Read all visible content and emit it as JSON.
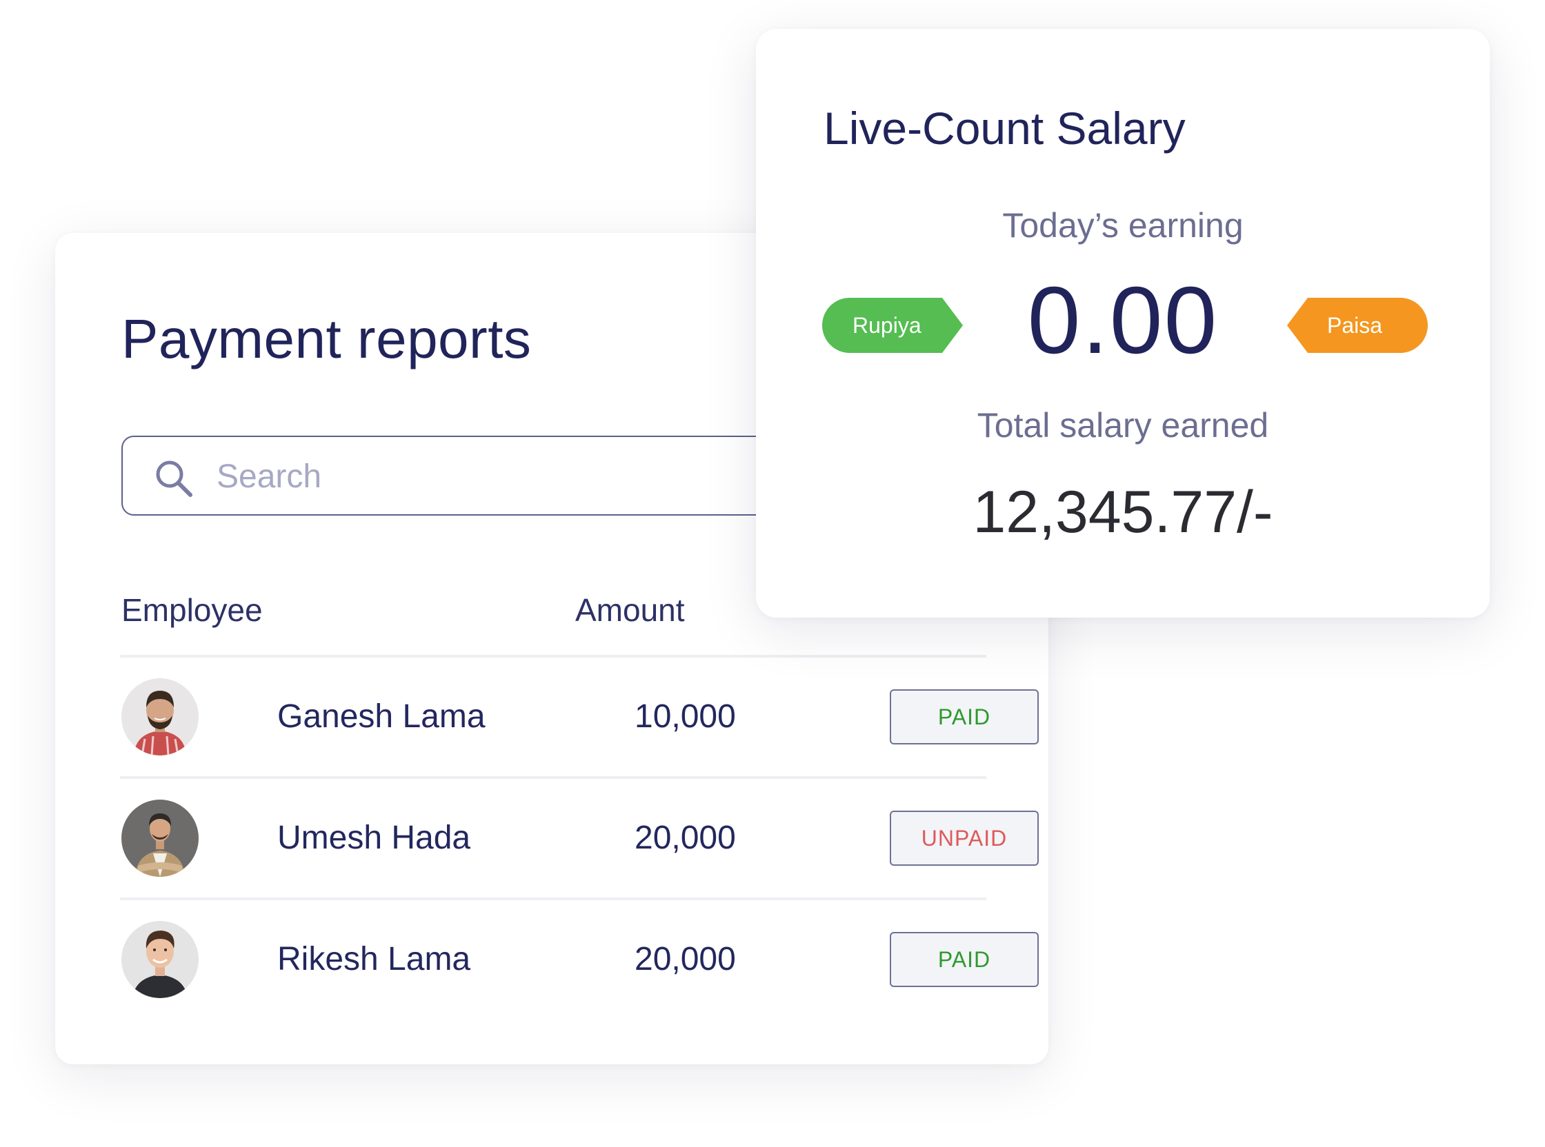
{
  "payment_reports": {
    "title": "Payment reports",
    "search": {
      "placeholder": "Search",
      "icon": "search-icon"
    },
    "columns": {
      "employee": "Employee",
      "amount": "Amount"
    },
    "rows": [
      {
        "name": "Ganesh Lama",
        "amount": "10,000",
        "status": "PAID"
      },
      {
        "name": "Umesh Hada",
        "amount": "20,000",
        "status": "UNPAID"
      },
      {
        "name": "Rikesh Lama",
        "amount": "20,000",
        "status": "PAID"
      }
    ]
  },
  "live_count": {
    "title": "Live-Count Salary",
    "todays_label": "Today’s earning",
    "value": "0.00",
    "rupiya_tag": "Rupiya",
    "paisa_tag": "Paisa",
    "total_label": "Total salary earned",
    "total_value": "12,345.77/-"
  },
  "colors": {
    "title": "#20245a",
    "rupiya_tag": "#55bd52",
    "paisa_tag": "#f4961f",
    "paid": "#2e9a2e",
    "unpaid": "#dd5a5a"
  }
}
